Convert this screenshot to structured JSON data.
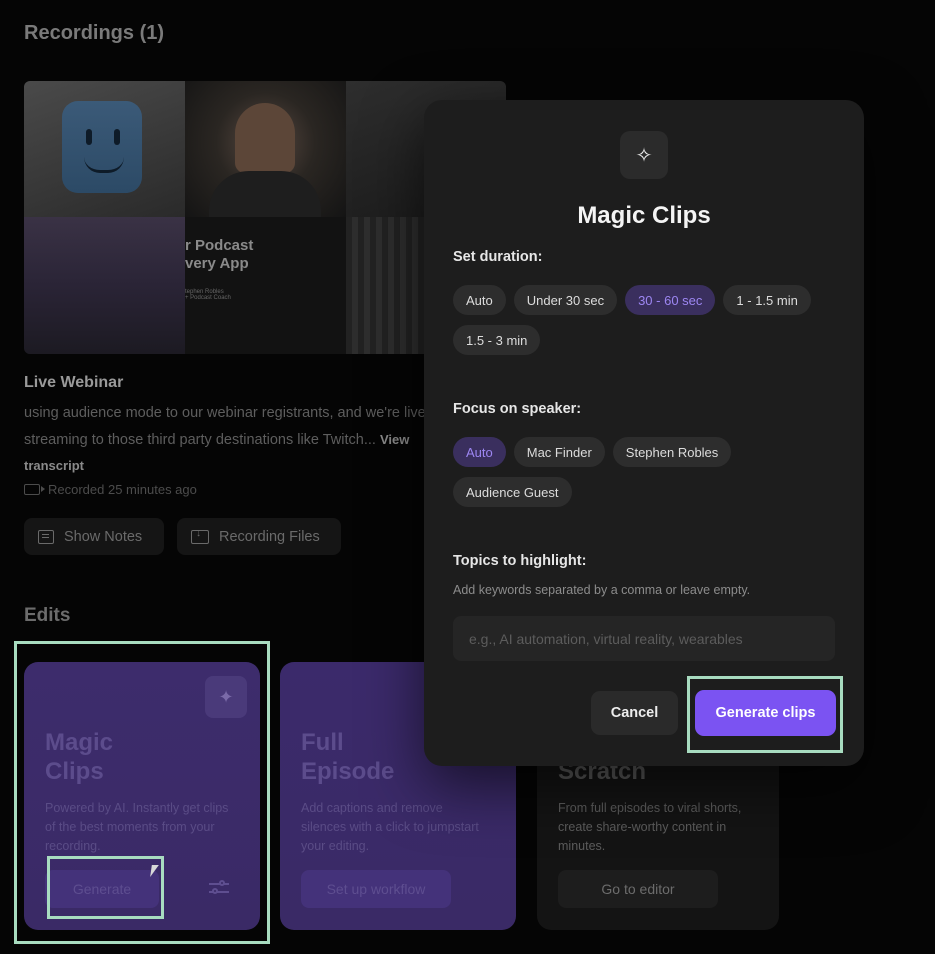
{
  "recordings": {
    "title": "Recordings (1)",
    "thumbnail": {
      "podcast_title": "r Podcast\nvery App",
      "speaker_caption": "tephen Robles\n+ Podcast Coach"
    },
    "item": {
      "title": "Live Webinar",
      "description": "using audience mode to our webinar registrants, and we're live streaming to those third party destinations like Twitch...",
      "view_transcript": "View transcript",
      "recorded": "Recorded 25 minutes ago"
    },
    "buttons": {
      "show_notes": "Show Notes",
      "recording_files": "Recording Files"
    }
  },
  "edits": {
    "title": "Edits",
    "cards": [
      {
        "title": "Magic Clips",
        "description": "Powered by AI. Instantly get clips of the best moments from your recording.",
        "button": "Generate"
      },
      {
        "title": "Full Episode",
        "description": "Add captions and remove silences with a click to jumpstart your editing.",
        "button": "Set up workflow"
      },
      {
        "title": "Scratch",
        "description": "From full episodes to viral shorts, create share-worthy content in minutes.",
        "button": "Go to editor"
      }
    ]
  },
  "modal": {
    "icon": "sparkle-icon",
    "title": "Magic Clips",
    "duration": {
      "label": "Set duration:",
      "options": [
        "Auto",
        "Under 30 sec",
        "30 - 60 sec",
        "1 - 1.5 min",
        "1.5 - 3 min"
      ],
      "selected": "30 - 60 sec"
    },
    "speaker": {
      "label": "Focus on speaker:",
      "options": [
        "Auto",
        "Mac Finder",
        "Stephen Robles",
        "Audience Guest"
      ],
      "selected": "Auto"
    },
    "topics": {
      "label": "Topics to highlight:",
      "hint": "Add keywords separated by a comma or leave empty.",
      "placeholder": "e.g., AI automation, virtual reality, wearables",
      "value": ""
    },
    "cancel": "Cancel",
    "generate": "Generate clips"
  },
  "colors": {
    "accent": "#7b53f2",
    "selected_chip_text": "#9d86f2",
    "highlight_frame": "#a8dcc0"
  }
}
